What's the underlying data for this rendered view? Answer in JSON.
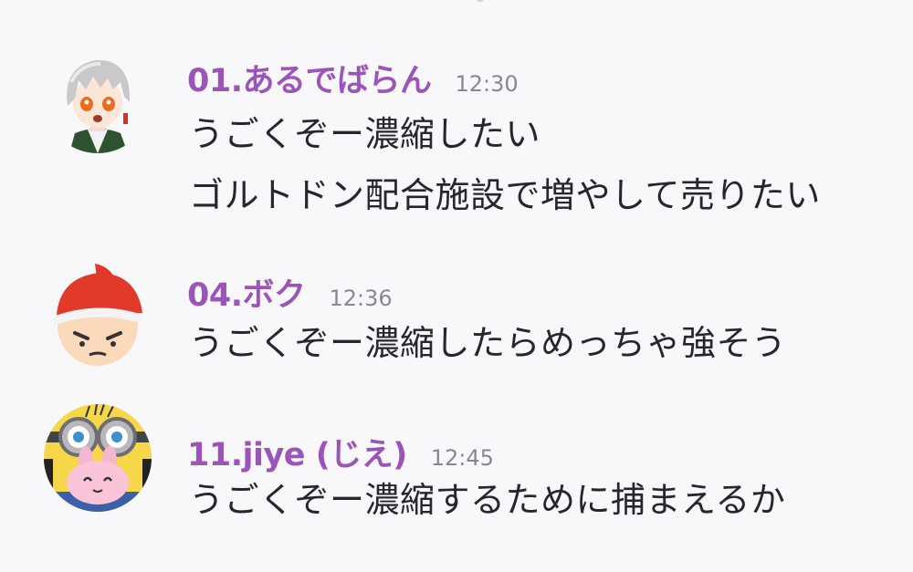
{
  "messages": [
    {
      "author": "01.あるでばらん",
      "time": "12:30",
      "avatar_icon": "white-haired-character-avatar-icon",
      "lines": [
        "うごくぞー濃縮したい",
        "ゴルトドン配合施設で増やして売りたい"
      ]
    },
    {
      "author": "04.ボク",
      "time": "12:36",
      "avatar_icon": "red-cap-boy-avatar-icon",
      "lines": [
        "うごくぞー濃縮したらめっちゃ強そう"
      ]
    },
    {
      "author": "11.jiye (じえ)",
      "time": "12:45",
      "avatar_icon": "goggles-pink-rabbit-avatar-icon",
      "lines": [
        "うごくぞー濃縮するために捕まえるか"
      ]
    }
  ],
  "colors": {
    "author_name": "#9b55b8",
    "timestamp": "#888890",
    "message_text": "#26262b",
    "background": "#f8f8fa"
  }
}
